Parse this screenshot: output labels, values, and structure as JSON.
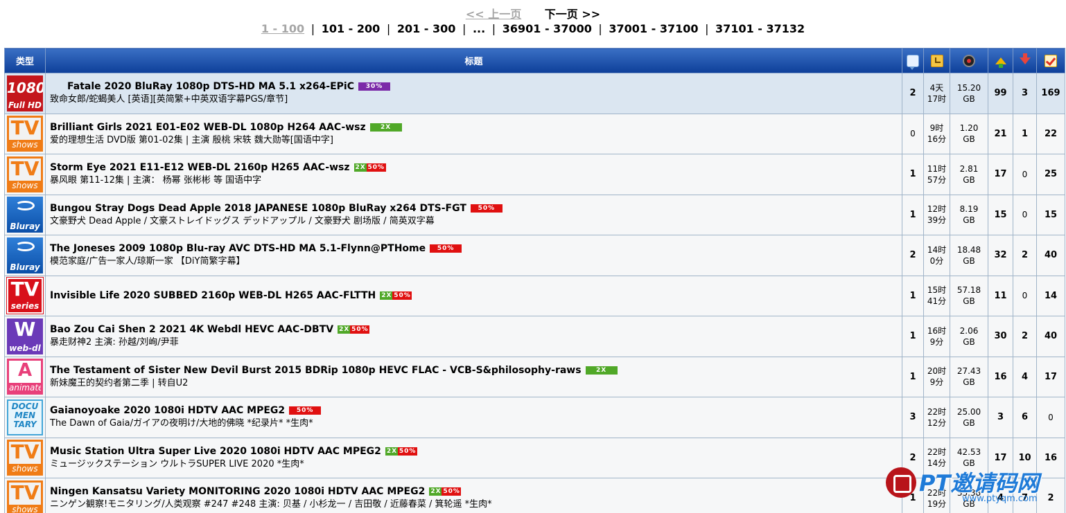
{
  "pager": {
    "prev": "<< 上一页",
    "next": "下一页 >>",
    "current": "1 - 100",
    "pages": [
      "101 - 200",
      "201 - 300",
      "...",
      "36901 - 37000",
      "37001 - 37100",
      "37101 - 37132"
    ]
  },
  "header": {
    "type": "类型",
    "title": "标题",
    "icons": [
      "comment-icon",
      "time-icon",
      "size-icon",
      "seeders-icon",
      "leechers-icon",
      "completed-icon"
    ]
  },
  "rows": [
    {
      "cat_big": "1080",
      "cat_small": "Full HD",
      "name": "Fatale 2020 BluRay 1080p DTS-HD MA 5.1 x264-EPiC",
      "sub": "致命女郎/蛇蝎美人 [英语][英简繁+中英双语字幕PGS/章节]",
      "promo": "30%",
      "comments": "2",
      "time1": "4天",
      "time2": "17时",
      "size1": "15.20",
      "size2": "GB",
      "seeders": "99",
      "leechers": "3",
      "done": "169"
    },
    {
      "cat_big": "TV",
      "cat_small": "shows",
      "name": "Brilliant Girls 2021 E01-E02 WEB-DL 1080p H264 AAC-wsz",
      "sub": "爱的理想生活 DVD版 第01-02集 | 主演 殷桃 宋轶 魏大勋等[国语中字]",
      "promo": "2X",
      "comments": "0",
      "time1": "9时",
      "time2": "16分",
      "size1": "1.20",
      "size2": "GB",
      "seeders": "21",
      "leechers": "1",
      "done": "22"
    },
    {
      "cat_big": "TV",
      "cat_small": "shows",
      "name": "Storm Eye 2021 E11-E12 WEB-DL 2160p H265 AAC-wsz",
      "sub": "暴风眼 第11-12集 | 主演： 杨幂 张彬彬 等 国语中字",
      "promo": "2X50%",
      "comments": "1",
      "time1": "11时",
      "time2": "57分",
      "size1": "2.81",
      "size2": "GB",
      "seeders": "17",
      "leechers": "0",
      "done": "25"
    },
    {
      "cat_big": "",
      "cat_small": "Bluray",
      "name": "Bungou Stray Dogs Dead Apple 2018 JAPANESE 1080p BluRay x264 DTS-FGT",
      "sub": "文豪野犬 Dead Apple / 文豪ストレイドッグス デッドアップル / 文豪野犬 剧场版 / 简英双字幕",
      "promo": "50%",
      "comments": "1",
      "time1": "12时",
      "time2": "39分",
      "size1": "8.19",
      "size2": "GB",
      "seeders": "15",
      "leechers": "0",
      "done": "15"
    },
    {
      "cat_big": "",
      "cat_small": "Bluray",
      "name": "The Joneses 2009 1080p Blu-ray AVC DTS-HD MA 5.1-Flynn@PTHome",
      "sub": "模范家庭/广告一家人/琼斯一家 【DiY简繁字幕】",
      "promo": "50%",
      "comments": "2",
      "time1": "14时",
      "time2": "0分",
      "size1": "18.48",
      "size2": "GB",
      "seeders": "32",
      "leechers": "2",
      "done": "40"
    },
    {
      "cat_big": "TV",
      "cat_small": "series",
      "name": "Invisible Life 2020 SUBBED 2160p WEB-DL H265 AAC-FLTTH",
      "sub": "",
      "promo": "2X50%",
      "comments": "1",
      "time1": "15时",
      "time2": "41分",
      "size1": "57.18",
      "size2": "GB",
      "seeders": "11",
      "leechers": "0",
      "done": "14"
    },
    {
      "cat_big": "W",
      "cat_small": "web-dl",
      "name": "Bao Zou Cai Shen 2 2021 4K Webdl HEVC AAC-DBTV",
      "sub": "暴走财神2 主演: 孙越/刘峋/尹菲",
      "promo": "2X50%",
      "comments": "1",
      "time1": "16时",
      "time2": "9分",
      "size1": "2.06",
      "size2": "GB",
      "seeders": "30",
      "leechers": "2",
      "done": "40"
    },
    {
      "cat_big": "A",
      "cat_small": "animate",
      "name": "The Testament of Sister New Devil Burst 2015 BDRip 1080p HEVC FLAC - VCB-S&philosophy-raws",
      "sub": "新妹魔王的契约者第二季 | 转自U2",
      "promo": "2X",
      "comments": "1",
      "time1": "20时",
      "time2": "9分",
      "size1": "27.43",
      "size2": "GB",
      "seeders": "16",
      "leechers": "4",
      "done": "17"
    },
    {
      "cat_big": "DOCU MEN TARY",
      "cat_small": "",
      "name": "Gaianoyoake 2020 1080i HDTV AAC MPEG2",
      "sub": "The Dawn of Gaia/ガイアの夜明け/大地的佛晓 *纪录片* *生肉*",
      "promo": "50%",
      "comments": "3",
      "time1": "22时",
      "time2": "12分",
      "size1": "25.00",
      "size2": "GB",
      "seeders": "3",
      "leechers": "6",
      "done": "0"
    },
    {
      "cat_big": "TV",
      "cat_small": "shows",
      "name": "Music Station Ultra Super Live 2020 1080i HDTV AAC MPEG2",
      "sub": "ミュージックステーション ウルトラSUPER LIVE 2020 *生肉*",
      "promo": "2X50%",
      "comments": "2",
      "time1": "22时",
      "time2": "14分",
      "size1": "42.53",
      "size2": "GB",
      "seeders": "17",
      "leechers": "10",
      "done": "16"
    },
    {
      "cat_big": "TV",
      "cat_small": "shows",
      "name": "Ningen Kansatsu Variety MONITORING 2020 1080i HDTV AAC MPEG2",
      "sub": "ニンゲン観察!モニタリング/人类观察 #247 #248 主演: 贝基 / 小杉龙一 / 吉田敬 / 近藤春菜 / 箕轮遥 *生肉*",
      "promo": "2X50%",
      "comments": "1",
      "time1": "22时",
      "time2": "19分",
      "size1": "33.38",
      "size2": "GB",
      "seeders": "4",
      "leechers": "7",
      "done": "2"
    }
  ],
  "watermark": {
    "text": "PT邀请码网",
    "url": "www.ptyqm.com"
  },
  "colors": {
    "header_bg": "#0d3f99",
    "row_bg": "#f6f7f8",
    "row_highlight": "#dbe6f1",
    "promo_50": "#e01010",
    "promo_2x": "#50a828",
    "promo_30": "#7b2aa8"
  }
}
